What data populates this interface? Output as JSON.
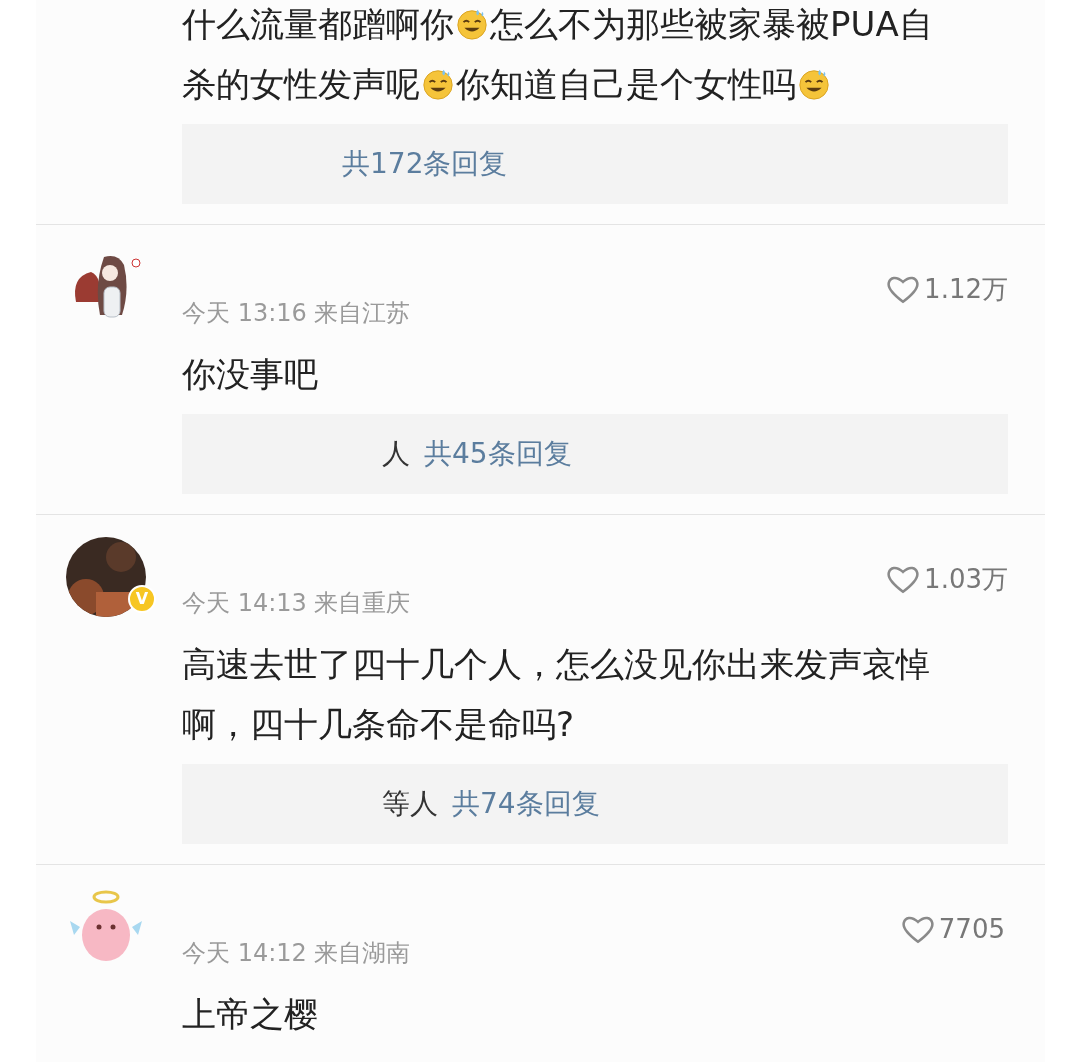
{
  "comments": [
    {
      "lines": [
        [
          {
            "kind": "text",
            "text": "什么流量都蹭啊你"
          },
          {
            "kind": "emoji"
          },
          {
            "kind": "text",
            "text": "怎么不为那些被家暴被PUA自"
          }
        ],
        [
          {
            "kind": "text",
            "text": "杀的女性发声呢"
          },
          {
            "kind": "emoji"
          },
          {
            "kind": "text",
            "text": "你知道自己是个女性吗"
          },
          {
            "kind": "emoji"
          }
        ]
      ],
      "reply": {
        "count": "共172条回复"
      }
    },
    {
      "avatar": {
        "kind": "picture"
      },
      "meta": "今天 13:16 来自江苏",
      "likes": "1.12万",
      "lines": [
        [
          {
            "kind": "text",
            "text": "你没事吧"
          }
        ]
      ],
      "reply": {
        "names": "人",
        "count": "共45条回复"
      }
    },
    {
      "avatar": {
        "kind": "picture"
      },
      "badge": "V",
      "meta": "今天 14:13 来自重庆",
      "likes": "1.03万",
      "lines": [
        [
          {
            "kind": "text",
            "text": "高速去世了四十几个人，怎么没见你出来发声哀悼"
          }
        ],
        [
          {
            "kind": "text",
            "text": "啊，四十几条命不是命吗?"
          }
        ]
      ],
      "reply": {
        "names": "等人",
        "count": "共74条回复"
      }
    },
    {
      "avatar": {
        "kind": "picture"
      },
      "meta": "今天 14:12 来自湖南",
      "likes": "7705",
      "lines": [
        [
          {
            "kind": "text",
            "text": "上帝之樱"
          }
        ]
      ]
    }
  ]
}
